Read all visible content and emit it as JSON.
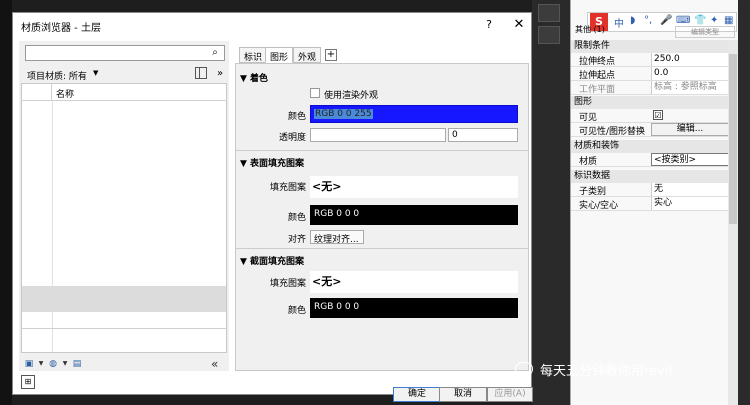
{
  "dialog": {
    "title": "材质浏览器 - 土层",
    "help": "?",
    "close": "✕",
    "search_icon": "search-icon",
    "filter_label": "项目材质: 所有",
    "list_header": "名称",
    "buttons": {
      "ok": "确定",
      "cancel": "取消",
      "apply": "应用(A)"
    }
  },
  "tabs": [
    "标识",
    "图形",
    "外观",
    "+"
  ],
  "active_tab": "图形",
  "shading": {
    "title": "▼ 着色",
    "use_render_label": "使用渲染外观",
    "color_label": "颜色",
    "color_value": "RGB 0 0 255",
    "transparency_label": "透明度",
    "transparency_value": "0"
  },
  "surface": {
    "title": "▼ 表面填充图案",
    "pattern_label": "填充图案",
    "pattern_value": "<无>",
    "color_label": "颜色",
    "color_value": "RGB 0 0 0",
    "align_label": "对齐",
    "align_button": "纹理对齐..."
  },
  "cut": {
    "title": "▼ 截面填充图案",
    "pattern_label": "填充图案",
    "pattern_value": "<无>",
    "color_label": "颜色",
    "color_value": "RGB 0 0 0"
  },
  "properties": {
    "ime_s": "S",
    "ime_items": [
      "中",
      "◗",
      "°,",
      "🎤",
      "⌨",
      "👕",
      "✦",
      "▦"
    ],
    "type_label": "其他 (1)",
    "edit_type": "编辑类型",
    "categories": [
      {
        "title": "限制条件",
        "rows": [
          [
            "拉伸终点",
            "250.0"
          ],
          [
            "拉伸起点",
            "0.0"
          ],
          [
            "工作平面",
            "标高 : 参照标高"
          ]
        ]
      },
      {
        "title": "图形",
        "rows": [
          [
            "可见",
            "☑"
          ],
          [
            "可见性/图形替换",
            "编辑..."
          ]
        ]
      },
      {
        "title": "材质和装饰",
        "rows": [
          [
            "材质",
            "<按类别>"
          ]
        ]
      },
      {
        "title": "标识数据",
        "rows": [
          [
            "子类别",
            "无"
          ],
          [
            "实心/空心",
            "实心"
          ]
        ]
      }
    ]
  },
  "watermark": "每天五分钟教你用revit",
  "colors": {
    "blue": "#1616ff",
    "black": "#000000",
    "accent": "#3c7fd0"
  }
}
